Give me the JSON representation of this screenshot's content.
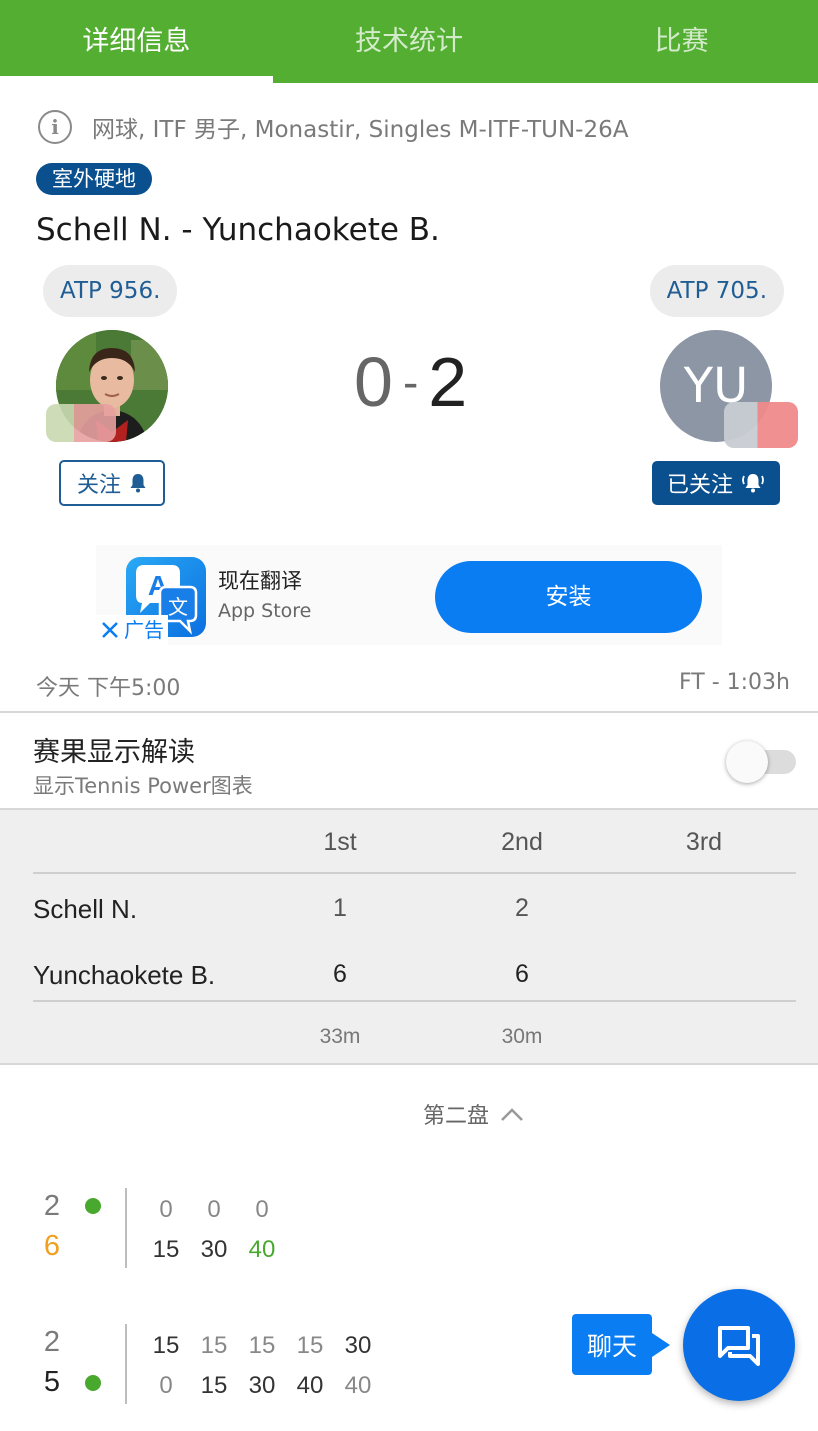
{
  "tabs": [
    {
      "label": "详细信息",
      "active": true
    },
    {
      "label": "技术统计",
      "active": false
    },
    {
      "label": "比赛",
      "active": false
    }
  ],
  "tournament_info": "网球, ITF 男子, Monastir, Singles M-ITF-TUN-26A",
  "surface": "室外硬地",
  "match_title": "Schell N. - Yunchaokete B.",
  "home": {
    "rank": "ATP 956.",
    "follow_label": "关注",
    "icon": "bell-icon"
  },
  "away": {
    "rank": "ATP 705.",
    "initials": "YU",
    "follow_label": "已关注",
    "icon": "bell-ringing-icon"
  },
  "score": {
    "home": "0",
    "separator": "-",
    "away": "2"
  },
  "ad": {
    "title": "现在翻译",
    "subtitle": "App Store",
    "install_label": "安装",
    "ad_label": "广告",
    "icon": "translate-app-icon"
  },
  "match_time": "今天 下午5:00",
  "match_status": "FT - 1:03h",
  "toggle": {
    "title": "赛果显示解读",
    "subtitle": "显示Tennis Power图表",
    "on": false
  },
  "set_table": {
    "headers": [
      "1st",
      "2nd",
      "3rd"
    ],
    "rows": [
      {
        "name": "Schell N.",
        "sets": [
          "1",
          "2",
          ""
        ]
      },
      {
        "name": "Yunchaokete B.",
        "sets": [
          "6",
          "6",
          ""
        ]
      }
    ],
    "durations": [
      "33m",
      "30m",
      ""
    ]
  },
  "set_selector": "第二盘",
  "games": [
    {
      "home_games": "2",
      "away_games": "6",
      "server": "home",
      "home_points": [
        "0",
        "0",
        "0"
      ],
      "away_points": [
        "15",
        "30",
        "40"
      ]
    },
    {
      "home_games": "2",
      "away_games": "5",
      "server": "away",
      "home_points": [
        "15",
        "15",
        "15",
        "15",
        "30"
      ],
      "away_points": [
        "0",
        "15",
        "30",
        "40",
        "40"
      ]
    }
  ],
  "chat_label": "聊天",
  "colors": {
    "green": "#53ae32",
    "navy": "#0a4f8e",
    "blue": "#0a7df2",
    "orange": "#f0a020",
    "point_green": "#49a82e"
  }
}
